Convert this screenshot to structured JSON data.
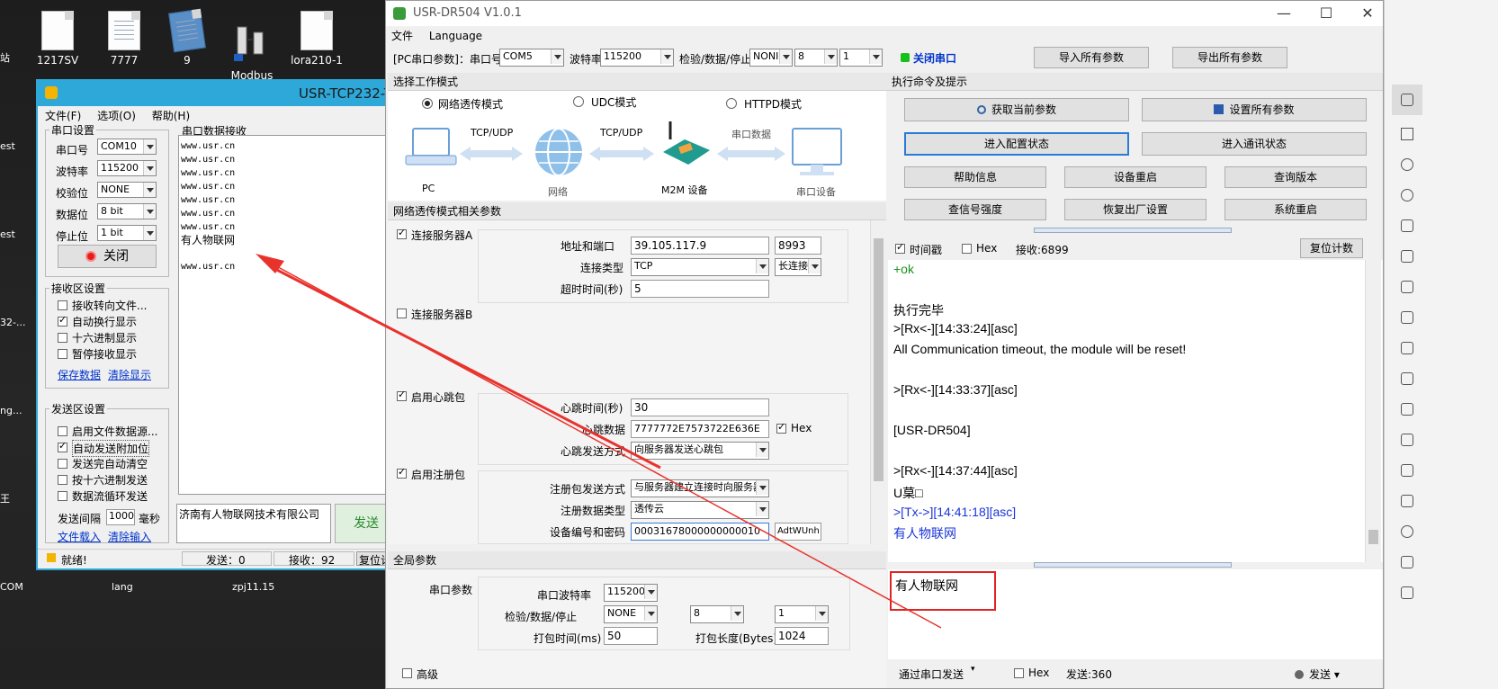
{
  "desktop": {
    "icons": [
      {
        "label": "1217SV"
      },
      {
        "label": "7777"
      },
      {
        "label": "9"
      },
      {
        "label": "Modbus\nPoll"
      },
      {
        "label": "lora210-1"
      }
    ],
    "edge_labels": [
      "站",
      "est",
      "est",
      "32-...",
      "ng...",
      "王",
      "COM",
      "lang",
      "zpj11.15"
    ]
  },
  "tcp": {
    "title": "USR-TCP232-Te",
    "menu": [
      "文件(F)",
      "选项(O)",
      "帮助(H)"
    ],
    "serial_group": "串口设置",
    "port_label": "串口号",
    "port_value": "COM10",
    "baud_label": "波特率",
    "baud_value": "115200",
    "parity_label": "校验位",
    "parity_value": "NONE",
    "data_label": "数据位",
    "data_value": "8 bit",
    "stop_label": "停止位",
    "stop_value": "1 bit",
    "close_button": "关闭",
    "recv_group": "接收区设置",
    "recv_opts": [
      "接收转向文件...",
      "自动换行显示",
      "十六进制显示",
      "暂停接收显示"
    ],
    "save_link": "保存数据",
    "clear_link": "清除显示",
    "send_group": "发送区设置",
    "send_opts": [
      "启用文件数据源...",
      "自动发送附加位",
      "发送完自动清空",
      "按十六进制发送",
      "数据流循环发送"
    ],
    "interval_label": "发送间隔",
    "interval_value": "1000",
    "interval_unit": "毫秒",
    "load_link": "文件载入",
    "clear_input_link": "清除输入",
    "recv_area_label": "串口数据接收",
    "recv_lines": [
      "www.usr.cn",
      "www.usr.cn",
      "www.usr.cn",
      "www.usr.cn",
      "www.usr.cn",
      "www.usr.cn",
      "www.usr.cn"
    ],
    "recv_highlight": "有人物联网",
    "recv_last": "www.usr.cn",
    "send_text": "济南有人物联网技术有限公司",
    "send_button": "发送",
    "status_ready": "就绪!",
    "status_sent": "发送：0",
    "status_recv": "接收：92",
    "status_reset": "复位计"
  },
  "dr": {
    "title": "USR-DR504 V1.0.1",
    "menu": [
      "文件",
      "Language"
    ],
    "toolbar": {
      "pc_label": "[PC串口参数]：串口号",
      "port": "COM5",
      "baud_label": "波特率",
      "baud": "115200",
      "check_label": "检验/数据/停止",
      "parity": "NONI",
      "databits": "8",
      "stopbits": "1",
      "close_serial": "关闭串口",
      "import": "导入所有参数",
      "export": "导出所有参数"
    },
    "mode": {
      "head": "选择工作模式",
      "options": [
        "网络透传模式",
        "UDC模式",
        "HTTPD模式"
      ],
      "diagram": {
        "pc": "PC",
        "tcp1": "TCP/UDP",
        "net": "网络",
        "tcp2": "TCP/UDP",
        "m2m": "M2M 设备",
        "serial": "串口数据",
        "dev": "串口设备"
      }
    },
    "netparams": {
      "head": "网络透传模式相关参数",
      "serverA": "连接服务器A",
      "addr_label": "地址和端口",
      "addr": "39.105.117.9",
      "port": "8993",
      "conn_label": "连接类型",
      "conn": "TCP",
      "conn2": "长连接",
      "timeout_label": "超时时间(秒)",
      "timeout": "5",
      "serverB": "连接服务器B",
      "heart": "启用心跳包",
      "heart_time_label": "心跳时间(秒)",
      "heart_time": "30",
      "heart_data_label": "心跳数据",
      "heart_data": "7777772E7573722E636E",
      "hex": "Hex",
      "heart_mode_label": "心跳发送方式",
      "heart_mode": "向服务器发送心跳包",
      "reg": "启用注册包",
      "reg_mode_label": "注册包发送方式",
      "reg_mode": "与服务器建立连接时向服务器",
      "reg_type_label": "注册数据类型",
      "reg_type": "透传云",
      "dev_label": "设备编号和密码",
      "dev_id": "00031678000000000010",
      "dev_pwd": "AdtWUnh"
    },
    "global": {
      "head": "全局参数",
      "serial_label": "串口参数",
      "baud_label": "串口波特率",
      "baud": "115200",
      "check_label": "检验/数据/停止",
      "parity": "NONE",
      "databits": "8",
      "stopbits": "1",
      "pack_time_label": "打包时间(ms)",
      "pack_time": "50",
      "pack_len_label": "打包长度(Bytes)",
      "pack_len": "1024",
      "advanced": "高级"
    },
    "cmd": {
      "head": "执行命令及提示",
      "buttons": [
        "获取当前参数",
        "设置所有参数",
        "进入配置状态",
        "进入通讯状态",
        "帮助信息",
        "设备重启",
        "查询版本",
        "查信号强度",
        "恢复出厂设置",
        "系统重启"
      ],
      "timestamp": "时间戳",
      "hex": "Hex",
      "recv": "接收:6899",
      "reset": "复位计数",
      "log": [
        {
          "t": "+ok",
          "c": "green"
        },
        {
          "t": "执行完毕",
          "c": ""
        },
        {
          "t": ">[Rx<-][14:33:24][asc]",
          "c": ""
        },
        {
          "t": "All Communication timeout, the module will be reset!",
          "c": ""
        },
        {
          "t": ">[Rx<-][14:33:37][asc]",
          "c": ""
        },
        {
          "t": "[USR-DR504]",
          "c": ""
        },
        {
          "t": ">[Rx<-][14:37:44][asc]",
          "c": ""
        },
        {
          "t": "U菒□",
          "c": ""
        },
        {
          "t": ">[Tx->][14:41:18][asc]",
          "c": "blue"
        },
        {
          "t": "有人物联网",
          "c": "blue"
        }
      ],
      "send_text": "有人物联网",
      "via": "通过串口发送",
      "send_hex": "Hex",
      "sent": "发送:360",
      "send_button": "发送"
    }
  }
}
